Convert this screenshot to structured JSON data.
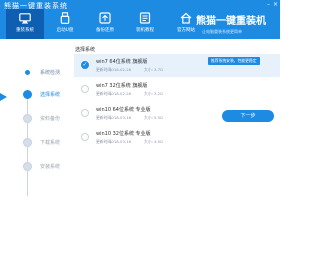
{
  "app": {
    "title": "熊猫一键重装系统",
    "brand_name": "熊猫一键重装机",
    "brand_slogan": "让电脑重装系统更简单"
  },
  "window_controls": {
    "minimize": "–",
    "close": "×"
  },
  "nav": {
    "items": [
      {
        "label": "重装系统",
        "icon": "monitor-icon",
        "active": true
      },
      {
        "label": "启动U盘",
        "icon": "usb-icon",
        "active": false
      },
      {
        "label": "备份还原",
        "icon": "backup-icon",
        "active": false
      },
      {
        "label": "装机教程",
        "icon": "tutorial-icon",
        "active": false
      },
      {
        "label": "官方网站",
        "icon": "home-icon",
        "active": false
      }
    ]
  },
  "steps": [
    {
      "label": "系统检测",
      "state": "done"
    },
    {
      "label": "选择系统",
      "state": "active"
    },
    {
      "label": "资料备份",
      "state": "pending"
    },
    {
      "label": "下载系统",
      "state": "pending"
    },
    {
      "label": "安装系统",
      "state": "pending"
    }
  ],
  "content": {
    "section_title": "选择系统",
    "date_label": "更新时间:",
    "size_label": "大小:",
    "recommend_badge": "推荐系统安装，性能更稳定",
    "next_button": "下一步",
    "os_list": [
      {
        "name": "win7 64位系统 旗舰版",
        "date": "2018-02-28",
        "size": "3.7G",
        "selected": true,
        "recommended": true
      },
      {
        "name": "win7 32位系统 旗舰版",
        "date": "2018-02-28",
        "size": "3.2G",
        "selected": false,
        "recommended": false
      },
      {
        "name": "win10 64位系统 专业版",
        "date": "2018-03-16",
        "size": "5.5G",
        "selected": false,
        "recommended": false
      },
      {
        "name": "win10 32位系统 专业版",
        "date": "2018-03-16",
        "size": "4.5G",
        "selected": false,
        "recommended": false
      }
    ]
  },
  "colors": {
    "primary": "#1e8be3",
    "nav_active": "#0e5eb2",
    "selected_row": "#e6f1fc"
  }
}
